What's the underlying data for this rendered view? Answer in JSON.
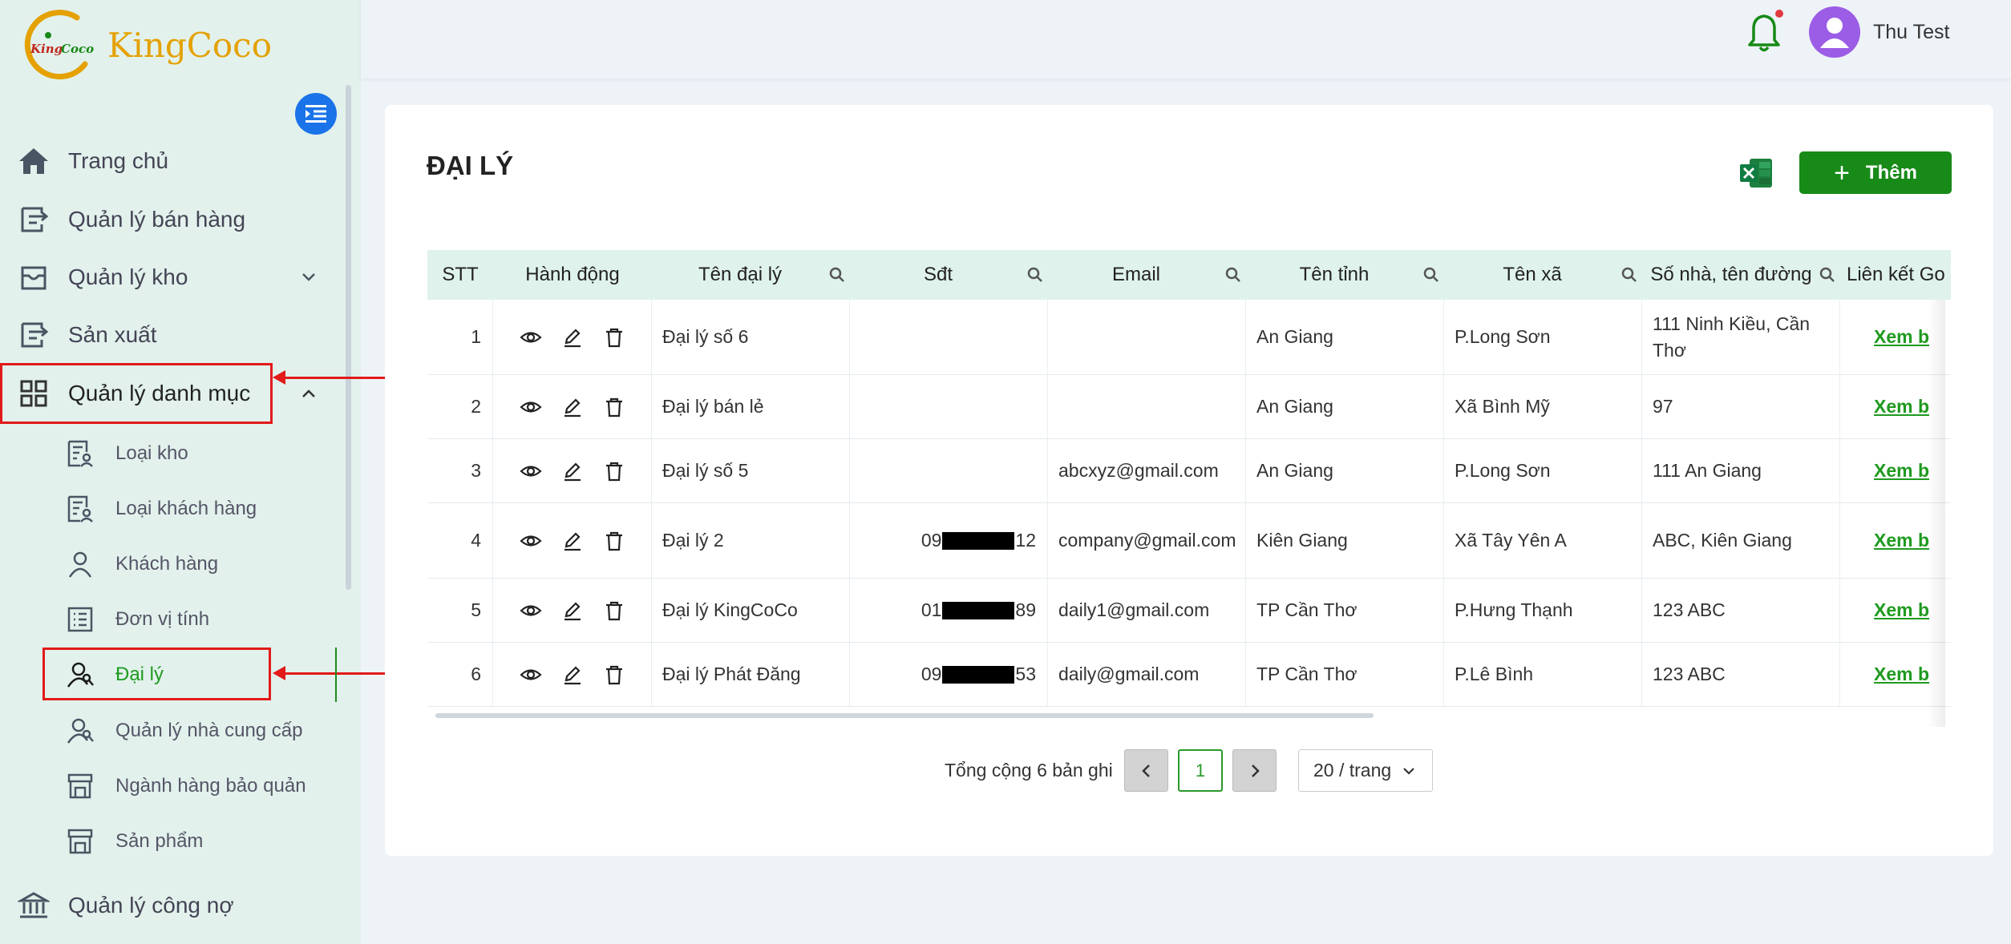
{
  "app": {
    "logo_text": "KingCoco",
    "logo_mark_text": "KingCoco"
  },
  "header": {
    "user_name": "Thu Test"
  },
  "sidebar": {
    "items": [
      {
        "label": "Trang chủ",
        "icon": "home-icon"
      },
      {
        "label": "Quản lý bán hàng",
        "icon": "sales-icon"
      },
      {
        "label": "Quản lý kho",
        "icon": "warehouse-icon"
      },
      {
        "label": "Sản xuất",
        "icon": "production-icon"
      },
      {
        "label": "Quản lý danh mục",
        "icon": "grid-icon"
      },
      {
        "label": "Quản lý công nợ",
        "icon": "bank-icon"
      }
    ],
    "sub_items": [
      {
        "label": "Loại kho",
        "icon": "doc-user-icon"
      },
      {
        "label": "Loại khách hàng",
        "icon": "doc-user-icon"
      },
      {
        "label": "Khách hàng",
        "icon": "user-icon"
      },
      {
        "label": "Đơn vị tính",
        "icon": "list-icon"
      },
      {
        "label": "Đại lý",
        "icon": "users-icon"
      },
      {
        "label": "Quản lý nhà cung cấp",
        "icon": "users-icon"
      },
      {
        "label": "Ngành hàng bảo quản",
        "icon": "store-icon"
      },
      {
        "label": "Sản phẩm",
        "icon": "store-icon"
      }
    ]
  },
  "page": {
    "title": "ĐẠI LÝ",
    "add_label": "Thêm"
  },
  "table": {
    "columns": [
      "STT",
      "Hành động",
      "Tên đại lý",
      "Sđt",
      "Email",
      "Tên tỉnh",
      "Tên xã",
      "Số nhà, tên đường",
      "Liên kết Go"
    ],
    "rows": [
      {
        "stt": "1",
        "name": "Đại lý số 6",
        "phone_pre": "",
        "phone_suf": "",
        "email": "",
        "province": "An Giang",
        "ward": "P.Long Sơn",
        "address": "111 Ninh Kiều, Cần Thơ",
        "link": "Xem b"
      },
      {
        "stt": "2",
        "name": "Đại lý bán lẻ",
        "phone_pre": "",
        "phone_suf": "",
        "email": "",
        "province": "An Giang",
        "ward": "Xã Bình Mỹ",
        "address": "97",
        "link": "Xem b"
      },
      {
        "stt": "3",
        "name": "Đại lý số 5",
        "phone_pre": "",
        "phone_suf": "",
        "email": "abcxyz@gmail.com",
        "province": "An Giang",
        "ward": "P.Long Sơn",
        "address": "111 An Giang",
        "link": "Xem b"
      },
      {
        "stt": "4",
        "name": "Đại lý 2",
        "phone_pre": "09",
        "phone_suf": "12",
        "email": "company@gmail.com",
        "province": "Kiên Giang",
        "ward": "Xã Tây Yên A",
        "address": "ABC, Kiên Giang",
        "link": "Xem b"
      },
      {
        "stt": "5",
        "name": "Đại lý KingCoCo",
        "phone_pre": "01",
        "phone_suf": "89",
        "email": "daily1@gmail.com",
        "province": "TP Cần Thơ",
        "ward": "P.Hưng Thạnh",
        "address": "123 ABC",
        "link": "Xem b"
      },
      {
        "stt": "6",
        "name": "Đại lý Phát Đăng",
        "phone_pre": "09",
        "phone_suf": "53",
        "email": "daily@gmail.com",
        "province": "TP Cần Thơ",
        "ward": "P.Lê Bình",
        "address": "123 ABC",
        "link": "Xem b"
      }
    ]
  },
  "pagination": {
    "total_text": "Tổng cộng 6 bản ghi",
    "current_page": "1",
    "page_size": "20 / trang"
  },
  "colors": {
    "primary_green": "#178a17",
    "sidebar_bg": "#e2f1ec",
    "annotation_red": "#e21a1a"
  }
}
